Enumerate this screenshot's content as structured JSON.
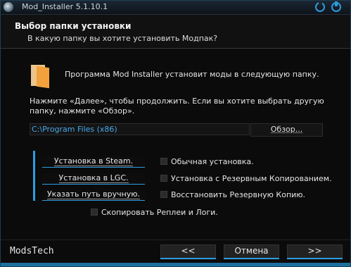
{
  "window": {
    "title": "Mod_Installer 5.1.10.1"
  },
  "header": {
    "title": "Выбор папки установки",
    "subtitle": "В какую папку вы хотите установить Модпак?"
  },
  "content": {
    "info_text": "Программа Mod Installer установит моды в следующую папку.",
    "instruction_text": "Нажмите «Далее», чтобы продолжить. Если вы хотите выбрать другую папку, нажмите «Обзор».",
    "path_value": "C:\\Program Files (x86)",
    "browse_label": "Обзор..."
  },
  "options": {
    "buttons": [
      "Установка в Steam.",
      "Установка в LGC.",
      "Указать путь вручную."
    ],
    "checkboxes": [
      "Обычная установка.",
      "Установка с Резервным Копированием.",
      "Восстановить Резервную Копию."
    ],
    "copy_replays": "Скопировать Реплеи и Логи."
  },
  "footer": {
    "brand": "ModsTech",
    "back_label": "<<",
    "cancel_label": "Отмена",
    "next_label": ">>"
  },
  "colors": {
    "accent": "#2e9de1",
    "path_text": "#49a8e8",
    "folder": "#f2a13c"
  },
  "icons": [
    "app-icon",
    "help-icon",
    "close-icon",
    "folder-icon"
  ]
}
